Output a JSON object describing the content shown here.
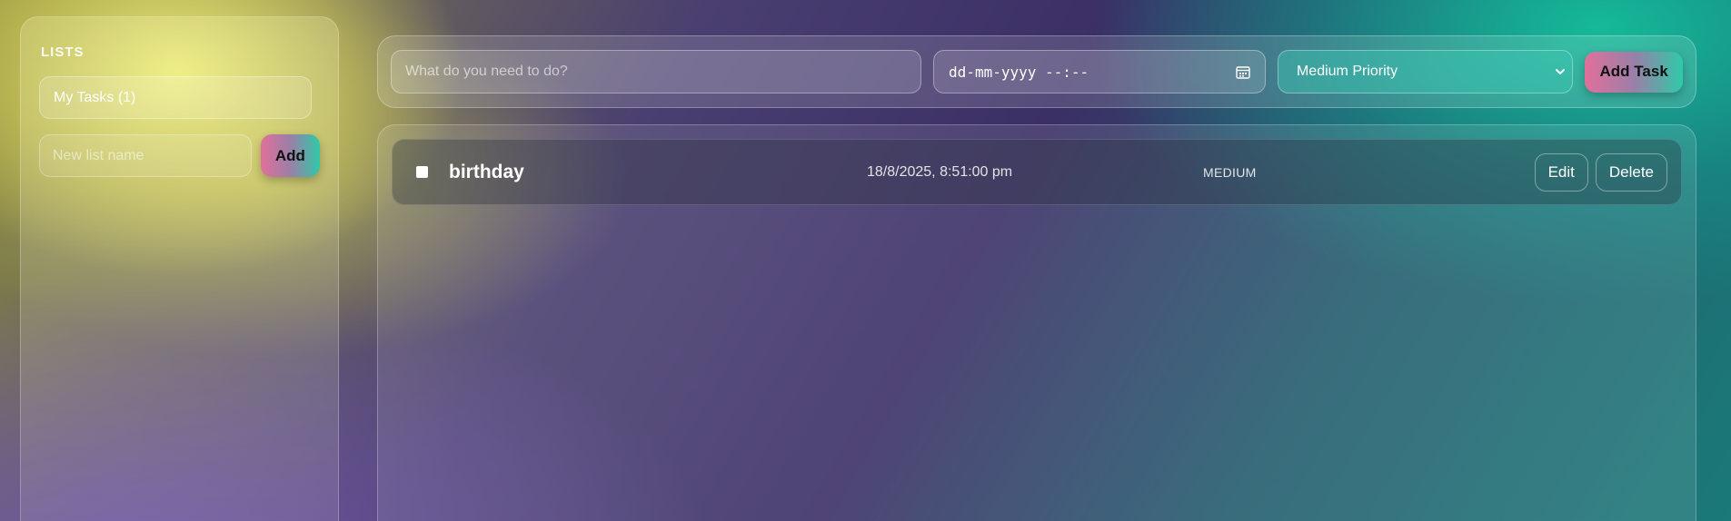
{
  "sidebar": {
    "title": "LISTS",
    "lists": [
      {
        "label": "My Tasks (1)"
      }
    ],
    "new_list": {
      "placeholder": "New list name",
      "add_label": "Add"
    }
  },
  "toolbar": {
    "task_placeholder": "What do you need to do?",
    "date_placeholder": "dd-mm-yyyy --:--",
    "priority_selected": "Medium Priority",
    "add_task_label": "Add Task"
  },
  "tasks": [
    {
      "title": "birthday",
      "due": "18/8/2025, 8:51:00 pm",
      "priority": "MEDIUM",
      "edit_label": "Edit",
      "delete_label": "Delete"
    }
  ],
  "colors": {
    "accent_gradient_start": "#e0709a",
    "accent_gradient_end": "#2fc9a8"
  }
}
